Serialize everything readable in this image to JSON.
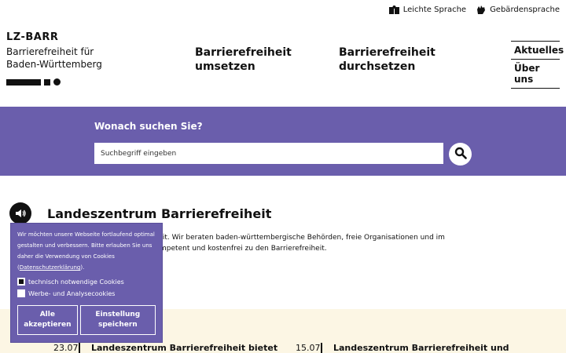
{
  "topbar": {
    "easy_language": "Leichte Sprache",
    "sign_language": "Gebärdensprache"
  },
  "logo": {
    "title": "LZ-BARR",
    "subtitle_line1": "Barrierefreiheit für",
    "subtitle_line2": "Baden-Württemberg"
  },
  "mainnav": [
    {
      "line1": "Barrierefreiheit",
      "line2": "umsetzen"
    },
    {
      "line1": "Barrierefreiheit",
      "line2": "durchsetzen"
    }
  ],
  "sidenav": [
    "Aktuelles",
    "Über uns"
  ],
  "search": {
    "label": "Wonach suchen Sie?",
    "placeholder": "Suchbegriff eingeben"
  },
  "main": {
    "title": "Landeszentrum Barrierefreiheit",
    "intro": "s Landeszentrums Barrierefreiheit. Wir beraten baden-württembergische Behörden, freie Organisationen und im Einzelfall auch Unternehmen kompetent und kostenfrei zu den Barrierefreiheit."
  },
  "news": [
    {
      "date": "23.07",
      "title": "Landeszentrum Barrierefreiheit bietet"
    },
    {
      "date": "15.07",
      "title": "Landeszentrum Barrierefreiheit und"
    }
  ],
  "cookie": {
    "text": "Wir möchten unsere Webseite fortlaufend optimal gestalten und verbessern. Bitte erlauben Sie uns daher die Verwendung von Cookies (",
    "link": "Datenschutzerklärung",
    "text_end": ").",
    "option_required": "technisch notwendige Cookies",
    "option_analytics": "Werbe- und Analysecookies",
    "accept_all_line1": "Alle",
    "accept_all_line2": "akzeptieren",
    "save_line1": "Einstellung",
    "save_line2": "speichern"
  }
}
